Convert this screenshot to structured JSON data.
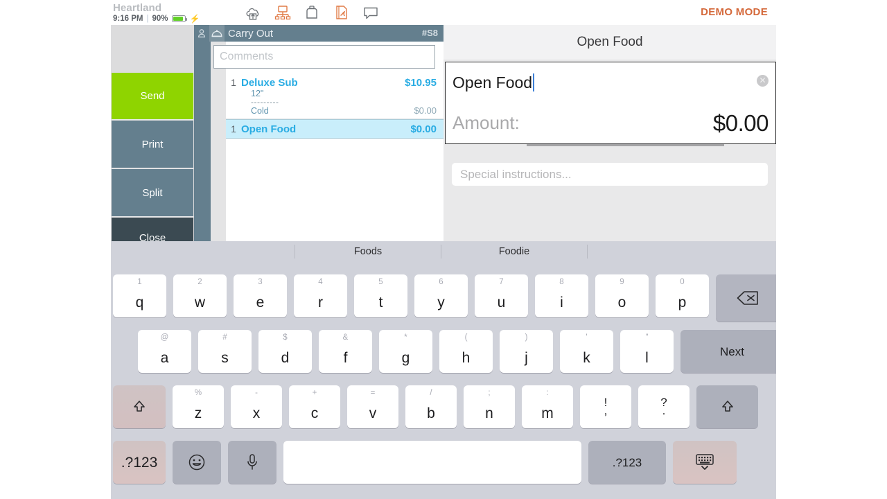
{
  "statusbar": {
    "brand": "Heartland",
    "time": "9:16 PM",
    "separator": "|",
    "battery_percent": "90%",
    "charging_icon": "charging-bolt-icon",
    "demo_mode": "DEMO MODE",
    "icons": [
      "cloud-upload-icon",
      "network-icon",
      "printer-icon",
      "document-signature-icon",
      "chat-bubble-icon"
    ]
  },
  "actions": [
    {
      "label": "Send",
      "color": "#8fd400"
    },
    {
      "label": "Print",
      "color": "#647f8e"
    },
    {
      "label": "Split",
      "color": "#647f8e"
    },
    {
      "label": "Close",
      "color": "#3b4a52"
    }
  ],
  "ticket": {
    "title": "Carry Out",
    "number": "#S8",
    "comments_placeholder": "Comments",
    "guest_icon": "person-icon",
    "order_type_icon": "food-dome-icon",
    "items": [
      {
        "qty": "1",
        "name": "Deluxe Sub",
        "price": "$10.95",
        "selected": false,
        "modifiers": [
          {
            "name": "12\"",
            "price": ""
          },
          {
            "divider": "---------"
          },
          {
            "name": "Cold",
            "price": "$0.00"
          }
        ]
      },
      {
        "qty": "1",
        "name": "Open Food",
        "price": "$0.00",
        "selected": true,
        "modifiers": []
      }
    ]
  },
  "detail": {
    "title": "Open Food",
    "name_value": "Open Food",
    "clear_icon": "clear-circle-icon",
    "amount_label": "Amount:",
    "amount_value": "$0.00",
    "special_placeholder": "Special instructions..."
  },
  "keyboard": {
    "suggestions": [
      "Foods",
      "Foodie"
    ],
    "row1": [
      {
        "alt": "1",
        "main": "q"
      },
      {
        "alt": "2",
        "main": "w"
      },
      {
        "alt": "3",
        "main": "e"
      },
      {
        "alt": "4",
        "main": "r"
      },
      {
        "alt": "5",
        "main": "t"
      },
      {
        "alt": "6",
        "main": "y"
      },
      {
        "alt": "7",
        "main": "u"
      },
      {
        "alt": "8",
        "main": "i"
      },
      {
        "alt": "9",
        "main": "o"
      },
      {
        "alt": "0",
        "main": "p"
      }
    ],
    "backspace_icon": "backspace-icon",
    "row2": [
      {
        "alt": "@",
        "main": "a"
      },
      {
        "alt": "#",
        "main": "s"
      },
      {
        "alt": "$",
        "main": "d"
      },
      {
        "alt": "&",
        "main": "f"
      },
      {
        "alt": "*",
        "main": "g"
      },
      {
        "alt": "(",
        "main": "h"
      },
      {
        "alt": ")",
        "main": "j"
      },
      {
        "alt": "'",
        "main": "k"
      },
      {
        "alt": "\"",
        "main": "l"
      }
    ],
    "next_label": "Next",
    "row3": [
      {
        "alt": "%",
        "main": "z"
      },
      {
        "alt": "-",
        "main": "x"
      },
      {
        "alt": "+",
        "main": "c"
      },
      {
        "alt": "=",
        "main": "v"
      },
      {
        "alt": "/",
        "main": "b"
      },
      {
        "alt": ";",
        "main": "n"
      },
      {
        "alt": ":",
        "main": "m"
      }
    ],
    "row3_punct": [
      {
        "top": "!",
        "bot": ","
      },
      {
        "top": "?",
        "bot": "."
      }
    ],
    "shift_left_icon": "shift-arrow-icon",
    "shift_right_icon": "shift-arrow-icon",
    "row4": {
      "numeric_left": ".?123",
      "emoji_icon": "emoji-smiley-icon",
      "mic_icon": "microphone-icon",
      "space": "",
      "numeric_right": ".?123",
      "hide_icon": "hide-keyboard-icon"
    }
  }
}
